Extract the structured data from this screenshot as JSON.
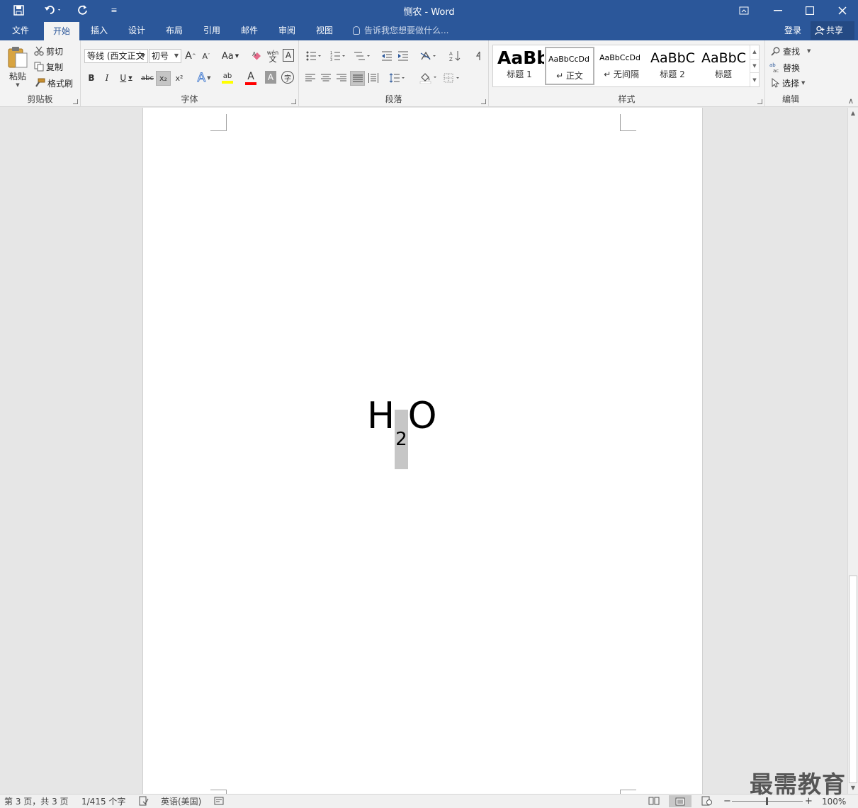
{
  "window": {
    "title": "恻农 - Word",
    "qat_customize": "≡"
  },
  "tabs": {
    "file": "文件",
    "home": "开始",
    "insert": "插入",
    "design": "设计",
    "layout": "布局",
    "references": "引用",
    "mailings": "邮件",
    "review": "审阅",
    "view": "视图"
  },
  "tellme": "告诉我您想要做什么...",
  "account": {
    "login": "登录",
    "share": "共享"
  },
  "clipboard": {
    "label": "剪贴板",
    "paste": "粘贴",
    "cut": "剪切",
    "copy": "复制",
    "format_painter": "格式刷"
  },
  "font": {
    "label": "字体",
    "name": "等线 (西文正文",
    "size": "初号",
    "grow": "A",
    "shrink": "A",
    "case": "Aa",
    "phonetic": "wén",
    "border_char": "A",
    "bold": "B",
    "italic": "I",
    "underline": "U",
    "strike": "abc",
    "subscript": "x₂",
    "superscript": "x²",
    "effects": "A",
    "highlight": "ab",
    "color": "A",
    "shading": "A",
    "enclose": "字"
  },
  "paragraph": {
    "label": "段落"
  },
  "styles": {
    "label": "样式",
    "items": [
      {
        "preview": "AaBb",
        "name": "标题 1"
      },
      {
        "preview": "AaBbCcDd",
        "name": "↵ 正文"
      },
      {
        "preview": "AaBbCcDd",
        "name": "↵ 无间隔"
      },
      {
        "preview": "AaBbC",
        "name": "标题 2"
      },
      {
        "preview": "AaBbC",
        "name": "标题"
      }
    ]
  },
  "editing": {
    "label": "编辑",
    "find": "查找",
    "replace": "替换",
    "select": "选择"
  },
  "document": {
    "base": "H",
    "subscript": "2",
    "tail": "O"
  },
  "status": {
    "page": "第 3 页，共 3 页",
    "words": "1/415 个字",
    "language": "英语(美国)",
    "zoom": "100%"
  },
  "watermark": "最需教育",
  "colors": {
    "accent": "#2b579a",
    "highlight_yellow": "#ffff00",
    "font_red": "#ff0000"
  }
}
